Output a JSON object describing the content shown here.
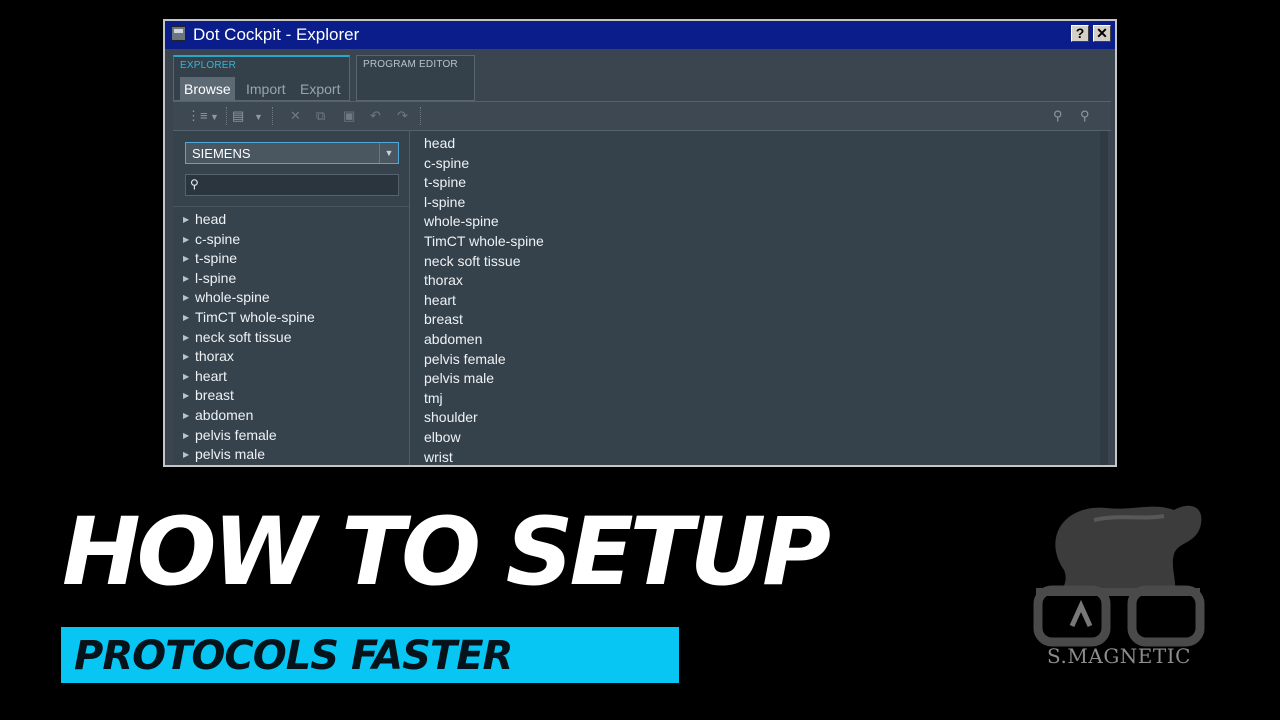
{
  "window": {
    "title": "Dot Cockpit - Explorer",
    "help_label": "?",
    "close_label": "✕"
  },
  "panels": {
    "explorer_caption": "EXPLORER",
    "program_editor_caption": "PROGRAM EDITOR",
    "subtabs": [
      {
        "label": "Browse",
        "active": true
      },
      {
        "label": "Import",
        "active": false
      },
      {
        "label": "Export",
        "active": false
      }
    ]
  },
  "toolbar": {
    "icons": [
      "tree-view-icon",
      "dropdown-arrow-icon",
      "add-folder-icon",
      "dropdown-arrow-icon",
      "delete-icon",
      "copy-icon",
      "paste-icon",
      "undo-icon",
      "redo-icon",
      "zoom-in-icon",
      "zoom-out-icon"
    ]
  },
  "left": {
    "vendor_value": "SIEMENS",
    "search_value": "",
    "tree_items": [
      "head",
      "c-spine",
      "t-spine",
      "l-spine",
      "whole-spine",
      "TimCT whole-spine",
      "neck soft tissue",
      "thorax",
      "heart",
      "breast",
      "abdomen",
      "pelvis female",
      "pelvis male"
    ]
  },
  "right": {
    "items": [
      "head",
      "c-spine",
      "t-spine",
      "l-spine",
      "whole-spine",
      "TimCT whole-spine",
      "neck soft tissue",
      "thorax",
      "heart",
      "breast",
      "abdomen",
      "pelvis female",
      "pelvis male",
      "tmj",
      "shoulder",
      "elbow",
      "wrist"
    ]
  },
  "overlay": {
    "headline": "HOW TO SETUP",
    "subheadline": "PROTOCOLS FASTER",
    "brand": "S.MAGNETIC",
    "banner_color": "#08c6f3"
  },
  "colors": {
    "titlebar": "#0a1d8a",
    "window_bg": "#3a4550",
    "accent": "#2aa6c8"
  }
}
